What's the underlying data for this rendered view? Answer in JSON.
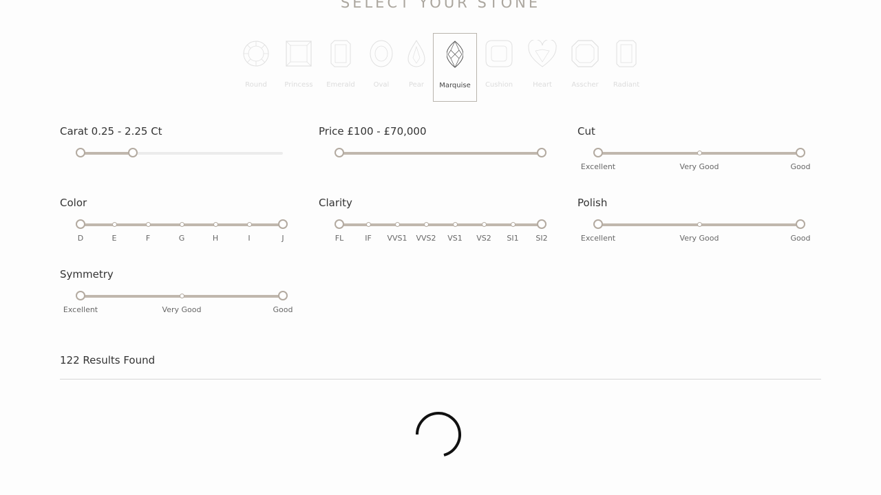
{
  "page": {
    "title": "SELECT YOUR STONE"
  },
  "shapes": [
    {
      "name": "Round",
      "icon": "round-diamond-icon",
      "selected": false
    },
    {
      "name": "Princess",
      "icon": "princess-diamond-icon",
      "selected": false
    },
    {
      "name": "Emerald",
      "icon": "emerald-diamond-icon",
      "selected": false
    },
    {
      "name": "Oval",
      "icon": "oval-diamond-icon",
      "selected": false
    },
    {
      "name": "Pear",
      "icon": "pear-diamond-icon",
      "selected": false
    },
    {
      "name": "Marquise",
      "icon": "marquise-diamond-icon",
      "selected": true
    },
    {
      "name": "Cushion",
      "icon": "cushion-diamond-icon",
      "selected": false
    },
    {
      "name": "Heart",
      "icon": "heart-diamond-icon",
      "selected": false
    },
    {
      "name": "Asscher",
      "icon": "asscher-diamond-icon",
      "selected": false
    },
    {
      "name": "Radiant",
      "icon": "radiant-diamond-icon",
      "selected": false
    }
  ],
  "filters": {
    "carat": {
      "title": "Carat 0.25 - 2.25 Ct",
      "min": 0.25,
      "max": 2.25,
      "selected_min": 0.25,
      "selected_max": 2.25,
      "range_fraction": [
        0,
        0.25
      ]
    },
    "price": {
      "title": "Price £100 - £70,000",
      "selected_min": "£100",
      "selected_max": "£70,000",
      "range_fraction": [
        0,
        1
      ]
    },
    "cut": {
      "title": "Cut",
      "ticks": [
        "Excellent",
        "Very Good",
        "Good"
      ]
    },
    "color": {
      "title": "Color",
      "ticks": [
        "D",
        "E",
        "F",
        "G",
        "H",
        "I",
        "J"
      ]
    },
    "clarity": {
      "title": "Clarity",
      "ticks": [
        "FL",
        "IF",
        "VVS1",
        "VVS2",
        "VS1",
        "VS2",
        "SI1",
        "SI2"
      ]
    },
    "polish": {
      "title": "Polish",
      "ticks": [
        "Excellent",
        "Very Good",
        "Good"
      ]
    },
    "symmetry": {
      "title": "Symmetry",
      "ticks": [
        "Excellent",
        "Very Good",
        "Good"
      ]
    }
  },
  "results": {
    "text": "122 Results Found"
  },
  "colors": {
    "accent": "#c0b7ad",
    "handle": "#b3aaa0",
    "muted_label": "#dcdcdc",
    "title": "#aba69e"
  },
  "status": {
    "loading": true
  }
}
